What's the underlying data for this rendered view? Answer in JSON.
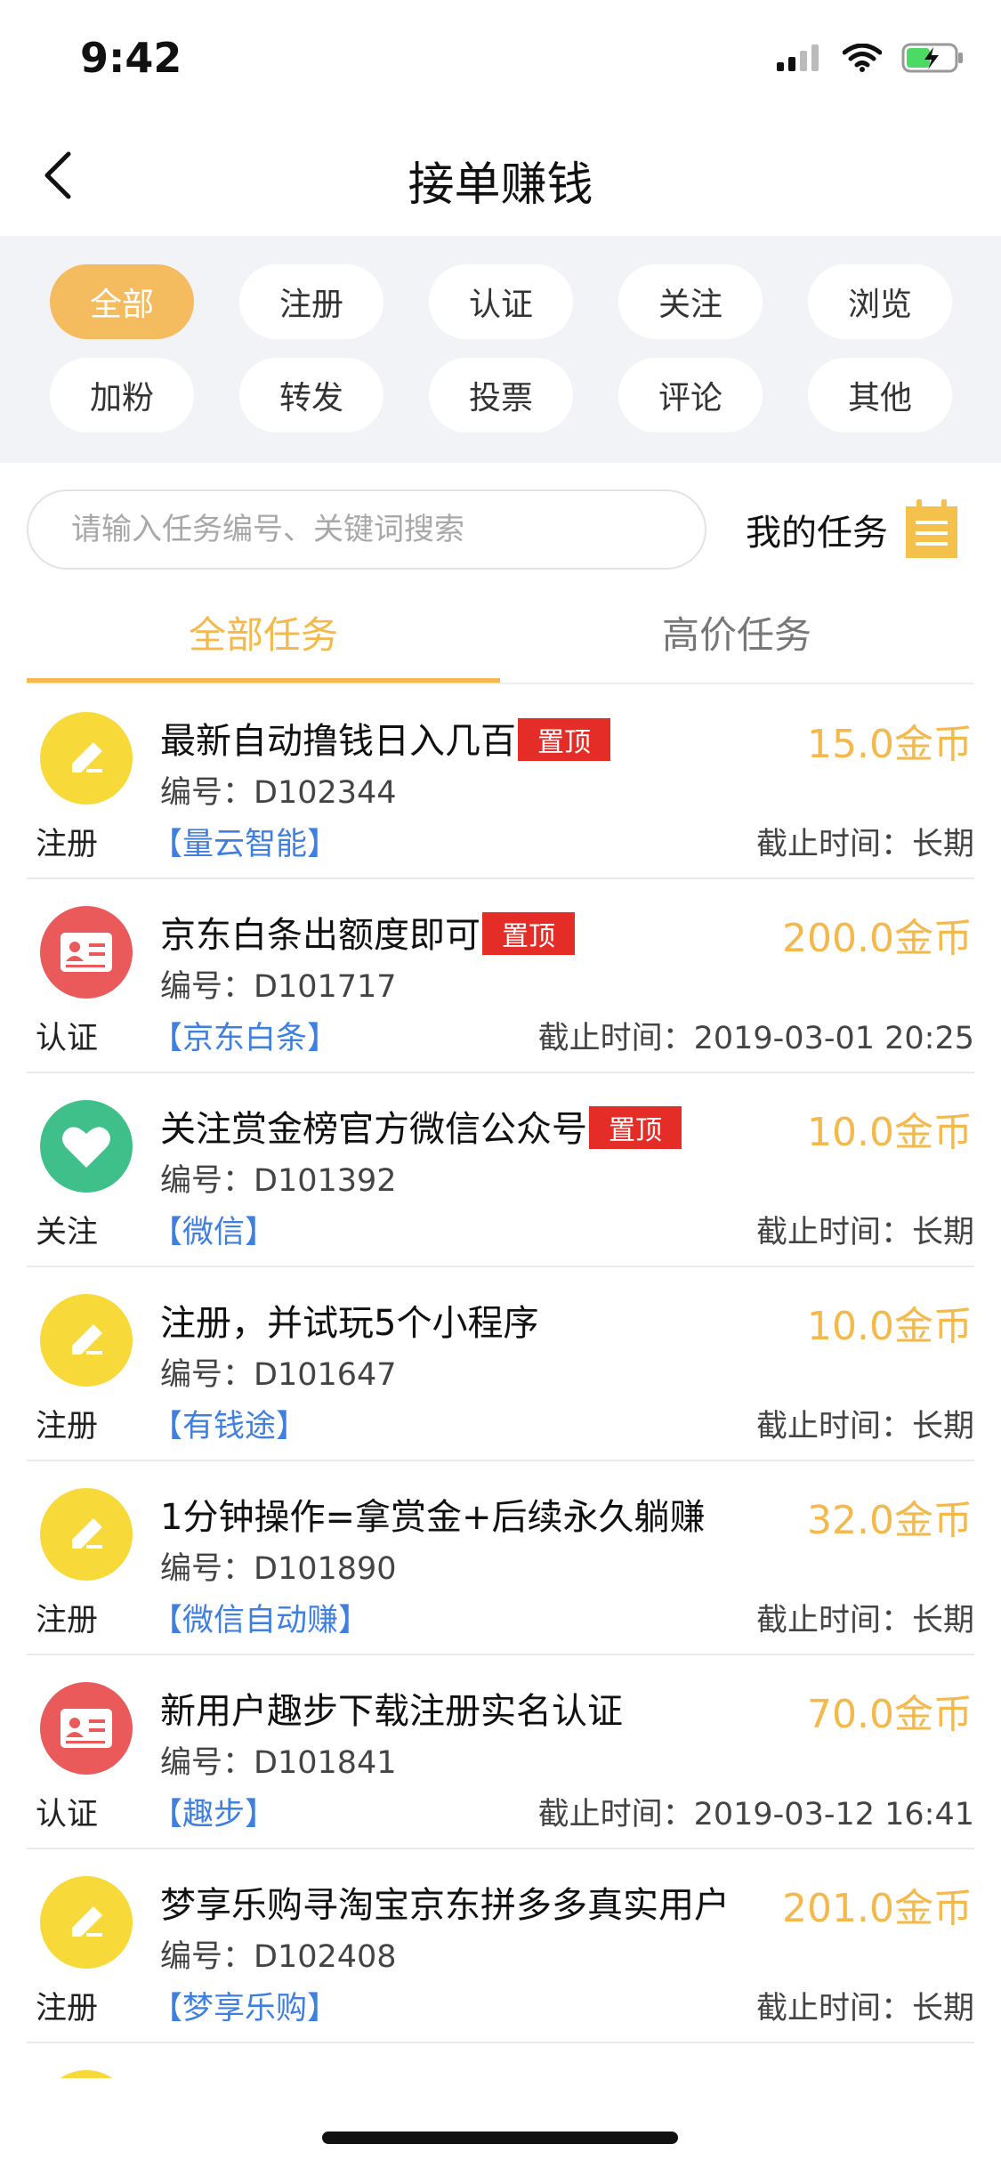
{
  "status_bar": {
    "time": "9:42"
  },
  "nav": {
    "title": "接单赚钱"
  },
  "filters": [
    "全部",
    "注册",
    "认证",
    "关注",
    "浏览",
    "加粉",
    "转发",
    "投票",
    "评论",
    "其他"
  ],
  "search": {
    "placeholder": "请输入任务编号、关键词搜索"
  },
  "my_tasks": {
    "label": "我的任务"
  },
  "tabs": [
    {
      "label": "全部任务",
      "active": true
    },
    {
      "label": "高价任务",
      "active": false
    }
  ],
  "id_prefix": "编号：",
  "deadline_prefix": "截止时间：",
  "tasks": [
    {
      "icon": "edit-icon",
      "title": "最新自动撸钱日入几百",
      "pinned": "置顶",
      "reward": "15.0金币",
      "id": "D102344",
      "category": "注册",
      "tag": "【量云智能】",
      "deadline": "长期"
    },
    {
      "icon": "id-card-icon",
      "title": "京东白条出额度即可",
      "pinned": "置顶",
      "reward": "200.0金币",
      "id": "D101717",
      "category": "认证",
      "tag": "【京东白条】",
      "deadline": "2019-03-01 20:25"
    },
    {
      "icon": "heart-icon",
      "title": "关注赏金榜官方微信公众号",
      "pinned": "置顶",
      "reward": "10.0金币",
      "id": "D101392",
      "category": "关注",
      "tag": "【微信】",
      "deadline": "长期"
    },
    {
      "icon": "edit-icon",
      "title": "注册，并试玩5个小程序",
      "pinned": "",
      "reward": "10.0金币",
      "id": "D101647",
      "category": "注册",
      "tag": "【有钱途】",
      "deadline": "长期"
    },
    {
      "icon": "edit-icon",
      "title": "1分钟操作=拿赏金+后续永久躺赚",
      "pinned": "",
      "reward": "32.0金币",
      "id": "D101890",
      "category": "注册",
      "tag": "【微信自动赚】",
      "deadline": "长期"
    },
    {
      "icon": "id-card-icon",
      "title": "新用户趣步下载注册实名认证",
      "pinned": "",
      "reward": "70.0金币",
      "id": "D101841",
      "category": "认证",
      "tag": "【趣步】",
      "deadline": "2019-03-12 16:41"
    },
    {
      "icon": "edit-icon",
      "title": "梦享乐购寻淘宝京东拼多多真实用户",
      "pinned": "",
      "reward": "201.0金币",
      "id": "D102408",
      "category": "注册",
      "tag": "【梦享乐购】",
      "deadline": "长期"
    }
  ],
  "colors": {
    "accent": "#f4b84b",
    "active_chip": "#f4bb5f",
    "pin": "#e52d27",
    "link": "#3e7fe0"
  }
}
